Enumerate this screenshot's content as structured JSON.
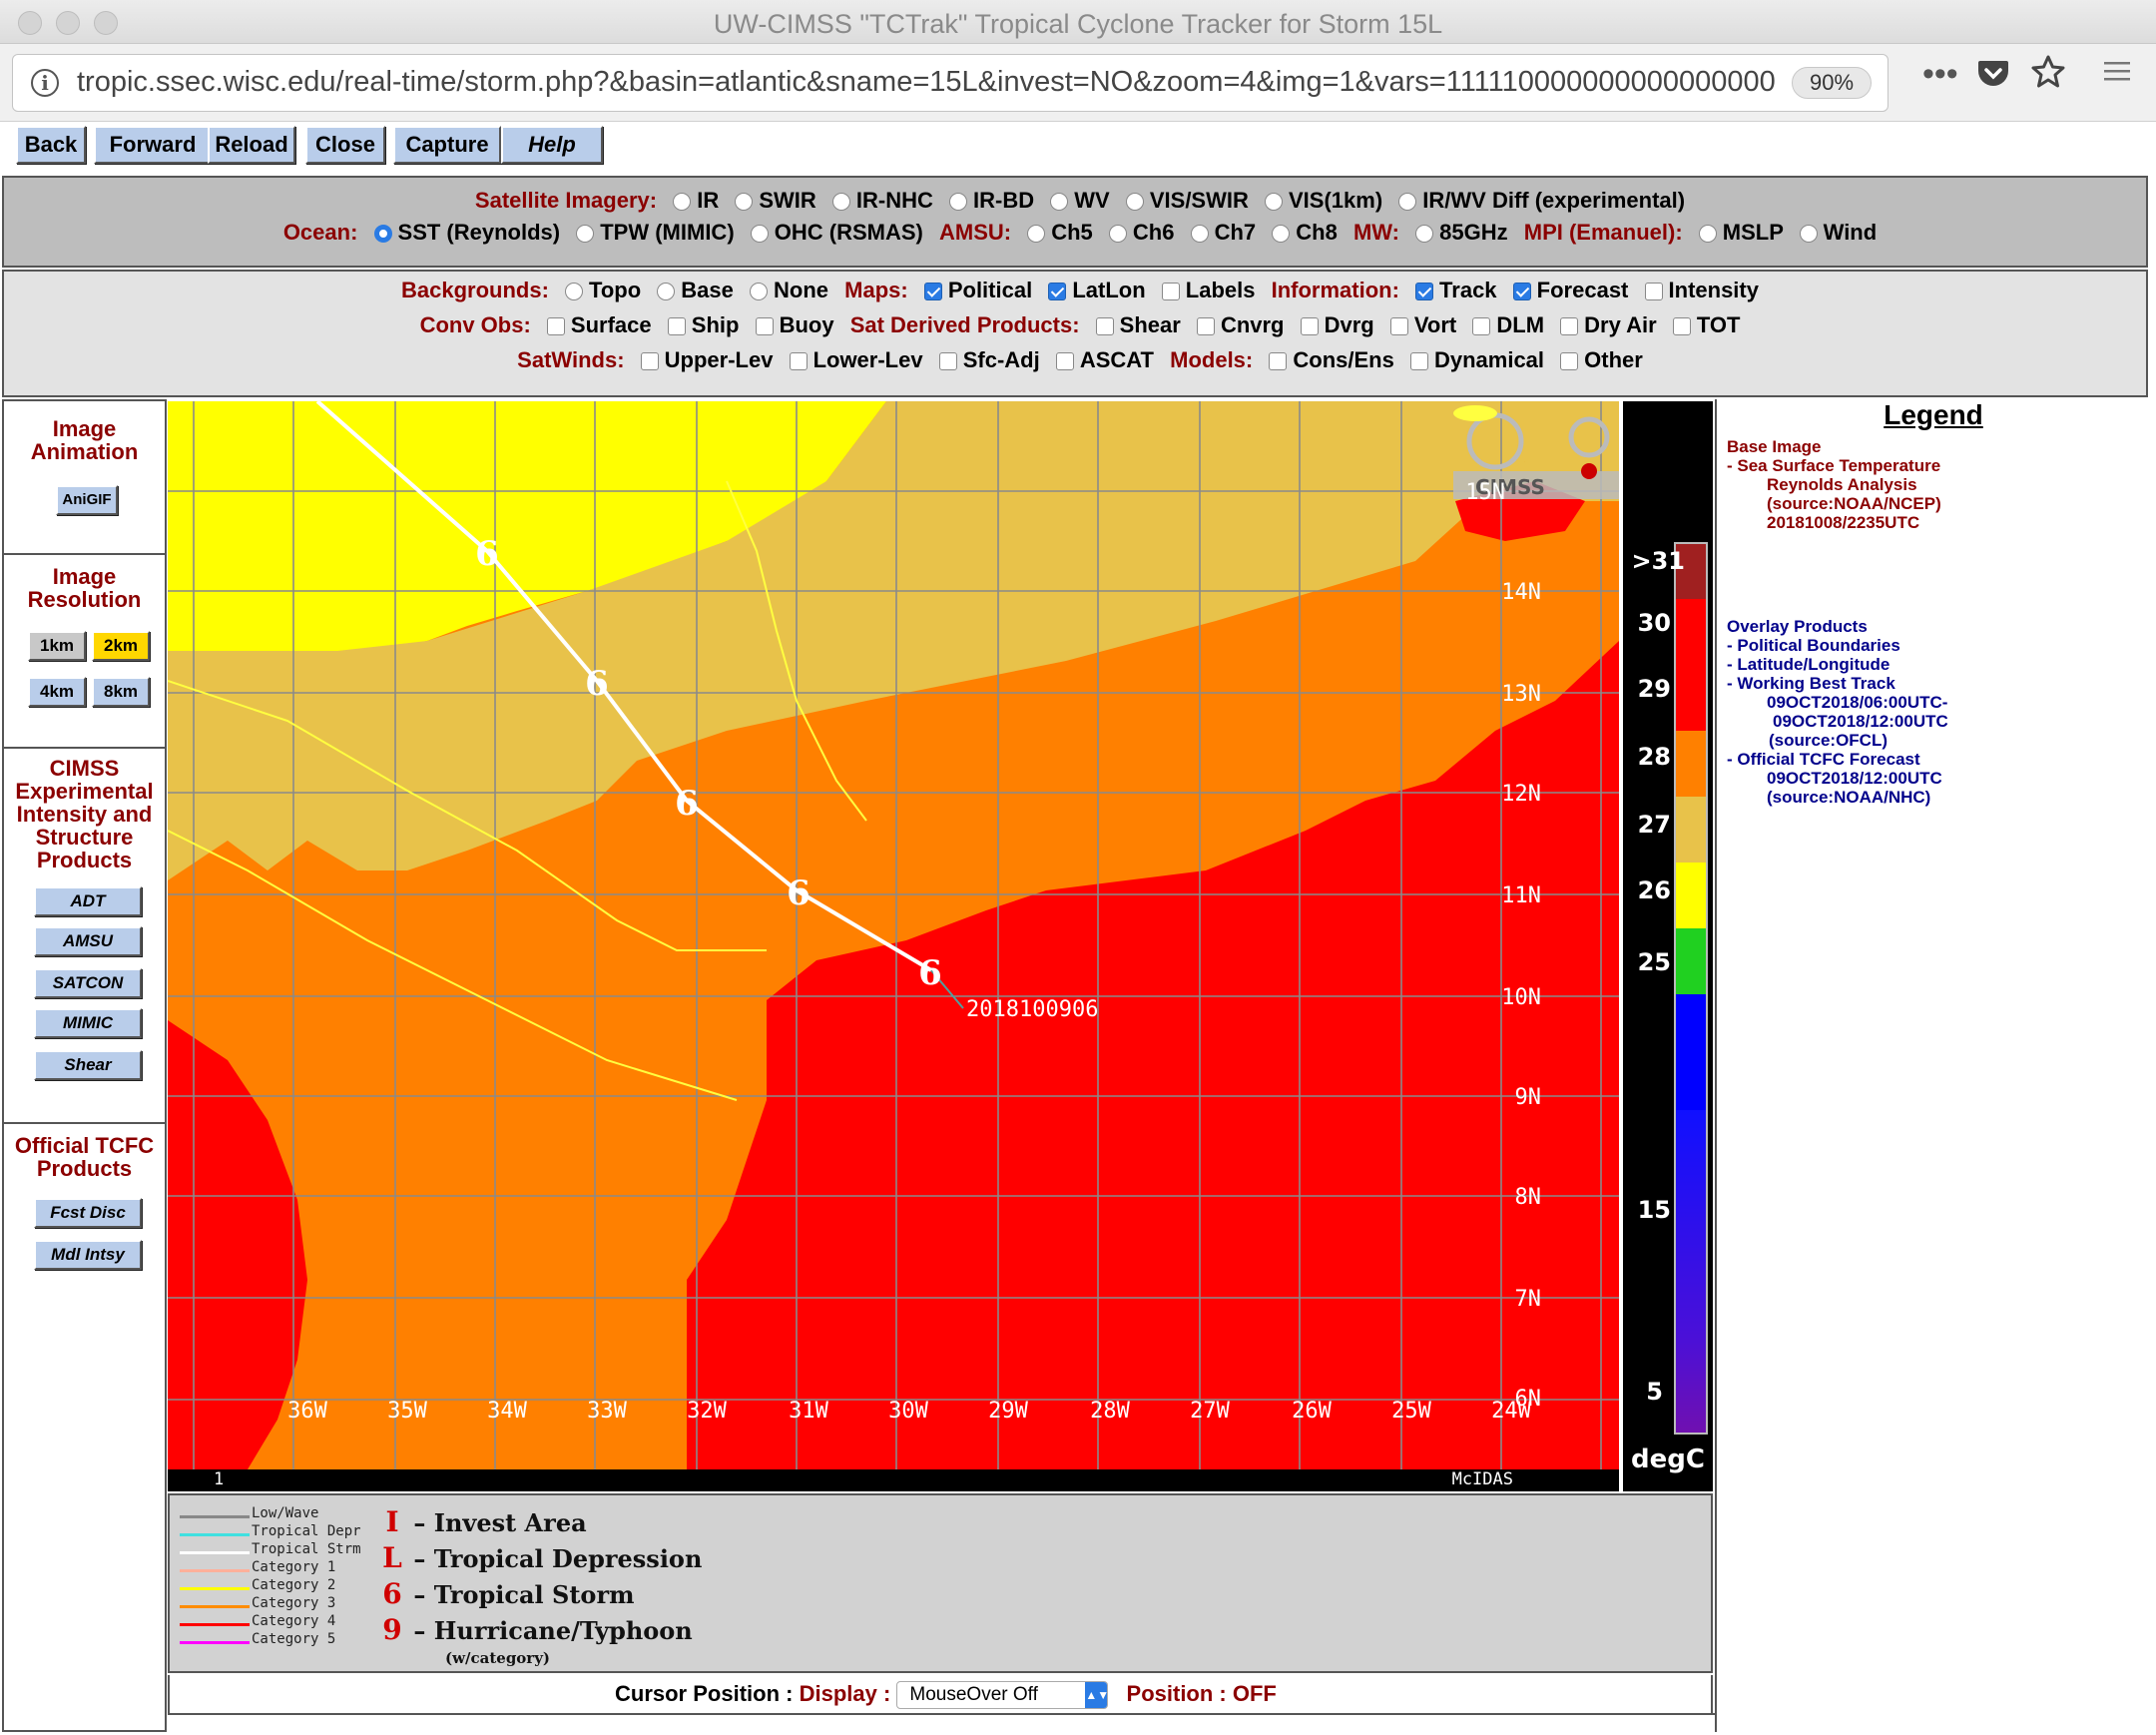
{
  "window": {
    "title": "UW-CIMSS \"TCTrak\" Tropical Cyclone Tracker for Storm 15L"
  },
  "browser": {
    "url": "tropic.ssec.wisc.edu/real-time/storm.php?&basin=atlantic&sname=15L&invest=NO&zoom=4&img=1&vars=111110000000000000000",
    "zoom": "90%",
    "icons": [
      "info-icon",
      "more-icon",
      "pocket-icon",
      "bookmark-star-icon",
      "menu-icon"
    ]
  },
  "nav_buttons": [
    "Back",
    "Forward",
    "Reload",
    "Close",
    "Capture",
    "Help"
  ],
  "satellite": {
    "label": "Satellite Imagery:",
    "options": [
      "IR",
      "SWIR",
      "IR-NHC",
      "IR-BD",
      "WV",
      "VIS/SWIR",
      "VIS(1km)",
      "IR/WV Diff (experimental)"
    ]
  },
  "ocean": {
    "label": "Ocean:",
    "options": [
      "SST (Reynolds)",
      "TPW (MIMIC)",
      "OHC (RSMAS)"
    ],
    "amsu_label": "AMSU:",
    "amsu_options": [
      "Ch5",
      "Ch6",
      "Ch7",
      "Ch8"
    ],
    "mw_label": "MW:",
    "mw_options": [
      "85GHz"
    ],
    "mpi_label": "MPI (Emanuel):",
    "mpi_options": [
      "MSLP",
      "Wind"
    ]
  },
  "backgrounds": {
    "label": "Backgrounds:",
    "options": [
      "Topo",
      "Base",
      "None"
    ],
    "maps_label": "Maps:",
    "maps_options": [
      "Political",
      "LatLon",
      "Labels"
    ],
    "info_label": "Information:",
    "info_options": [
      "Track",
      "Forecast",
      "Intensity"
    ]
  },
  "conv_obs": {
    "label": "Conv Obs:",
    "options": [
      "Surface",
      "Ship",
      "Buoy"
    ],
    "sat_label": "Sat Derived Products:",
    "sat_options": [
      "Shear",
      "Cnvrg",
      "Dvrg",
      "Vort",
      "DLM",
      "Dry Air",
      "TOT"
    ]
  },
  "satwinds": {
    "label": "SatWinds:",
    "options": [
      "Upper-Lev",
      "Lower-Lev",
      "Sfc-Adj",
      "ASCAT"
    ],
    "models_label": "Models:",
    "models_options": [
      "Cons/Ens",
      "Dynamical",
      "Other"
    ]
  },
  "sidebar": {
    "animation_title": "Image Animation",
    "anigif": "AniGIF",
    "resolution_title": "Image Resolution",
    "resolutions": [
      "1km",
      "2km",
      "4km",
      "8km"
    ],
    "selected_resolution": "2km",
    "cimss_title": "CIMSS Experimental Intensity and Structure Products",
    "cimss_buttons": [
      "ADT",
      "AMSU",
      "SATCON",
      "MIMIC",
      "Shear"
    ],
    "tcfc_title": "Official TCFC Products",
    "tcfc_buttons": [
      "Fcst Disc",
      "Mdl Intsy"
    ]
  },
  "map": {
    "lon_labels": [
      "36W",
      "35W",
      "34W",
      "33W",
      "32W",
      "31W",
      "30W",
      "29W",
      "28W",
      "27W",
      "26W",
      "25W",
      "24W"
    ],
    "lat_labels": [
      "15N",
      "14N",
      "13N",
      "12N",
      "11N",
      "10N",
      "9N",
      "8N",
      "7N",
      "6N"
    ],
    "track_label": "2018100906",
    "bottom_left": "1",
    "bottom_right": "McIDAS",
    "colors": {
      "yellow": "#ffff00",
      "gold": "#e8c24a",
      "orange": "#ff8000",
      "red": "#ff0000",
      "track": "#ffffff"
    }
  },
  "colorbar": {
    "labels": [
      ">31",
      "30",
      "29",
      "28",
      "27",
      "26",
      "25",
      "15",
      "5"
    ],
    "unit": "degC"
  },
  "legend": {
    "title": "Legend",
    "base_title": "Base Image",
    "base_lines": [
      "-  Sea Surface Temperature",
      "Reynolds Analysis",
      "(source:NOAA/NCEP)",
      "20181008/2235UTC"
    ],
    "overlay_title": "Overlay Products",
    "overlay_lines": [
      "-  Political Boundaries",
      "-  Latitude/Longitude",
      "-  Working Best Track",
      "09OCT2018/06:00UTC-",
      "09OCT2018/12:00UTC",
      "(source:OFCL)",
      "-  Official TCFC Forecast",
      "09OCT2018/12:00UTC",
      "(source:NOAA/NHC)"
    ]
  },
  "track_legend": {
    "lines": [
      {
        "label": "Low/Wave",
        "color": "#888888"
      },
      {
        "label": "Tropical Depr",
        "color": "#40e0e0"
      },
      {
        "label": "Tropical Strm",
        "color": "#ffffff"
      },
      {
        "label": "Category 1",
        "color": "#ffb09a"
      },
      {
        "label": "Category 2",
        "color": "#ffff00"
      },
      {
        "label": "Category 3",
        "color": "#ff8c00"
      },
      {
        "label": "Category 4",
        "color": "#ff0000"
      },
      {
        "label": "Category 5",
        "color": "#ff00ff"
      }
    ],
    "symbols": [
      {
        "glyph": "I",
        "label": "– Invest Area"
      },
      {
        "glyph": "L",
        "label": "– Tropical Depression"
      },
      {
        "glyph": "6",
        "label": "– Tropical Storm"
      },
      {
        "glyph": "9",
        "label": "– Hurricane/Typhoon"
      }
    ],
    "category_note": "(w/category)"
  },
  "cursor": {
    "label": "Cursor Position :",
    "display_label": "Display :",
    "select_value": "MouseOver Off",
    "position_label": "Position :",
    "position_value": "OFF"
  }
}
